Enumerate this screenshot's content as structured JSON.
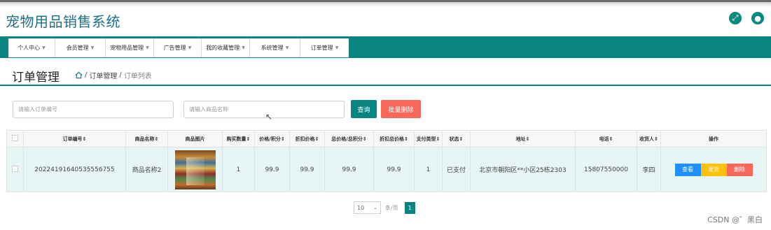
{
  "app": {
    "title": "宠物用品销售系统"
  },
  "top_icons": {
    "fullscreen": "fullscreen-icon",
    "user": "user-icon"
  },
  "nav": {
    "items": [
      {
        "label": "个人中心"
      },
      {
        "label": "会员管理"
      },
      {
        "label": "宠物用品管理"
      },
      {
        "label": "广告管理"
      },
      {
        "label": "我的收藏管理"
      },
      {
        "label": "系统管理"
      },
      {
        "label": "订单管理"
      }
    ]
  },
  "page": {
    "title": "订单管理",
    "breadcrumb": {
      "home_icon": "home-icon",
      "level1": "订单管理",
      "level2": "订单列表",
      "separator": "/"
    }
  },
  "search": {
    "order_no_placeholder": "请输入订单编号",
    "product_name_placeholder": "请输入商品名称",
    "query_label": "查询",
    "batch_delete_label": "批量删除"
  },
  "table": {
    "headers": [
      "订单编号",
      "商品名称",
      "商品图片",
      "购买数量",
      "价格/积分",
      "折扣价格",
      "总价格/总积分",
      "折扣总价格",
      "支付类型",
      "状态",
      "地址",
      "电话",
      "收货人",
      "操作"
    ],
    "sort_mark": "⇕",
    "rows": [
      {
        "order_no": "20224191640535556755",
        "product_name": "商品名称2",
        "quantity": "1",
        "price": "99.9",
        "discount_price": "99.9",
        "total_price": "99.9",
        "discount_total": "99.9",
        "pay_type": "1",
        "status": "已支付",
        "address": "北京市朝阳区**小区25栋2303",
        "phone": "15807550000",
        "receiver": "李四",
        "actions": {
          "view": "查看",
          "ship": "发货",
          "delete": "删除"
        }
      }
    ]
  },
  "pager": {
    "page_size": "10",
    "per_page_label": "条/页",
    "current_page": "1"
  },
  "watermark": "CSDN @゛黑白",
  "colors": {
    "primary": "#0a8480",
    "danger": "#f7685b",
    "info": "#1e90ff",
    "warning": "#ffc107",
    "row_bg": "#e7f6f4"
  }
}
